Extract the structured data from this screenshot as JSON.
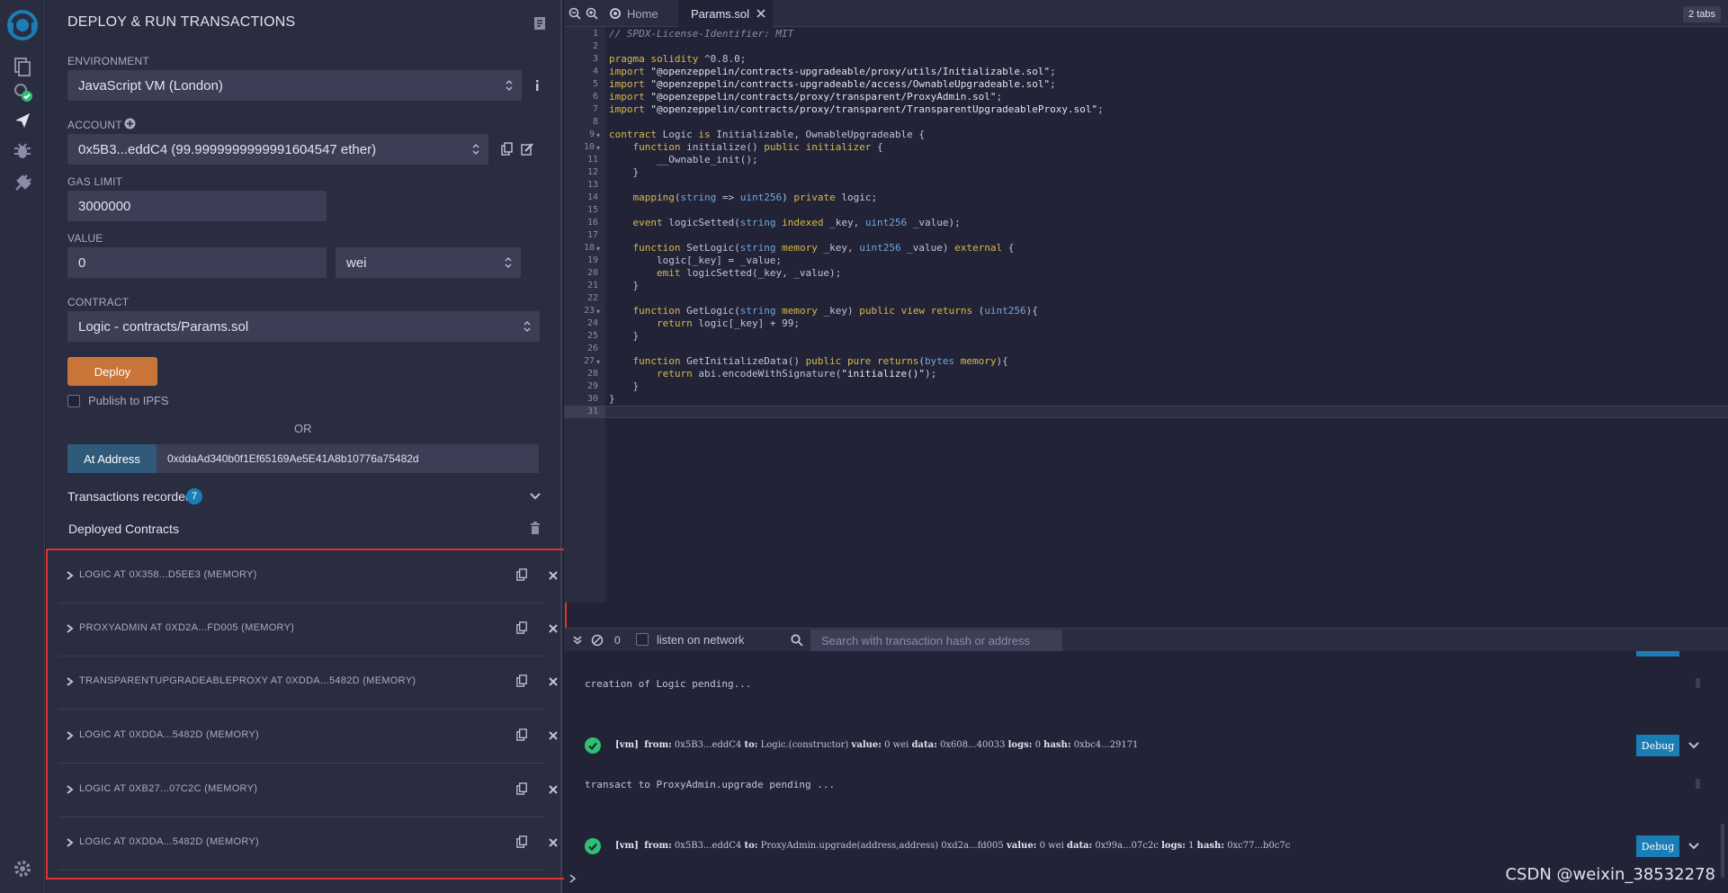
{
  "sidepanel": {
    "title": "DEPLOY & RUN TRANSACTIONS",
    "environment_label": "ENVIRONMENT",
    "environment_value": "JavaScript VM (London)",
    "account_label": "ACCOUNT",
    "account_value": "0x5B3...eddC4 (99.9999999999991604547 ether)",
    "gas_label": "GAS LIMIT",
    "gas_value": "3000000",
    "value_label": "VALUE",
    "value_amount": "0",
    "value_unit": "wei",
    "contract_label": "CONTRACT",
    "contract_value": "Logic - contracts/Params.sol",
    "deploy_label": "Deploy",
    "publish_label": "Publish to IPFS",
    "or_label": "OR",
    "at_address_label": "At Address",
    "at_address_value": "0xddaAd340b0f1Ef65169Ae5E41A8b10776a75482d",
    "tx_recorded_label": "Transactions recorded",
    "tx_recorded_count": "7",
    "deployed_label": "Deployed Contracts",
    "deployed_contracts": [
      "LOGIC AT 0X358...D5EE3 (MEMORY)",
      "PROXYADMIN AT 0XD2A...FD005 (MEMORY)",
      "TRANSPARENTUPGRADEABLEPROXY AT 0XDDA...5482D (MEMORY)",
      "LOGIC AT 0XDDA...5482D (MEMORY)",
      "LOGIC AT 0XB27...07C2C (MEMORY)",
      "LOGIC AT 0XDDA...5482D (MEMORY)"
    ]
  },
  "tabbar": {
    "home_label": "Home",
    "file_label": "Params.sol",
    "tabs_count": "2 tabs"
  },
  "editor": {
    "lines": [
      "// SPDX-License-Identifier: MIT",
      "",
      "pragma solidity ^0.8.0;",
      "import \"@openzeppelin/contracts-upgradeable/proxy/utils/Initializable.sol\";",
      "import \"@openzeppelin/contracts-upgradeable/access/OwnableUpgradeable.sol\";",
      "import \"@openzeppelin/contracts/proxy/transparent/ProxyAdmin.sol\";",
      "import \"@openzeppelin/contracts/proxy/transparent/TransparentUpgradeableProxy.sol\";",
      "",
      "contract Logic is Initializable, OwnableUpgradeable {",
      "    function initialize() public initializer {",
      "        __Ownable_init();",
      "    }",
      "",
      "    mapping(string => uint256) private logic;",
      "",
      "    event logicSetted(string indexed _key, uint256 _value);",
      "",
      "    function SetLogic(string memory _key, uint256 _value) external {",
      "        logic[_key] = _value;",
      "        emit logicSetted(_key, _value);",
      "    }",
      "",
      "    function GetLogic(string memory _key) public view returns (uint256){",
      "        return logic[_key] + 99;",
      "    }",
      "",
      "    function GetInitializeData() public pure returns(bytes memory){",
      "        return abi.encodeWithSignature(\"initialize()\");",
      "    }",
      "}",
      ""
    ],
    "fold_lines": [
      9,
      10,
      18,
      23,
      27
    ]
  },
  "terminal": {
    "pending_count": "0",
    "listen_label": "listen on network",
    "search_placeholder": "Search with transaction hash or address",
    "pending1": "creation of Logic pending...",
    "log1": {
      "vm": "[vm]",
      "from_label": "from:",
      "from": "0x5B3...eddC4",
      "to_label": "to:",
      "to": "Logic.(constructor)",
      "value_label": "value:",
      "value": "0 wei",
      "data_label": "data:",
      "data": "0x608...40033",
      "logs_label": "logs:",
      "logs": "0",
      "hash_label": "hash:",
      "hash": "0xbc4...29171"
    },
    "pending2": "transact to ProxyAdmin.upgrade pending ...",
    "log2": {
      "vm": "[vm]",
      "from_label": "from:",
      "from": "0x5B3...eddC4",
      "to_label": "to:",
      "to": "ProxyAdmin.upgrade(address,address) 0xd2a...fd005",
      "value_label": "value:",
      "value": "0 wei",
      "data_label": "data:",
      "data": "0x99a...07c2c",
      "logs_label": "logs:",
      "logs": "1",
      "hash_label": "hash:",
      "hash": "0xc77...b0c7c"
    },
    "debug_label": "Debug",
    "watermark": "CSDN @weixin_38532278"
  },
  "colors": {
    "accent": "#1a7eb5",
    "deploy": "#c97539",
    "highlight_border": "#e0352b",
    "success": "#2fbf71"
  }
}
